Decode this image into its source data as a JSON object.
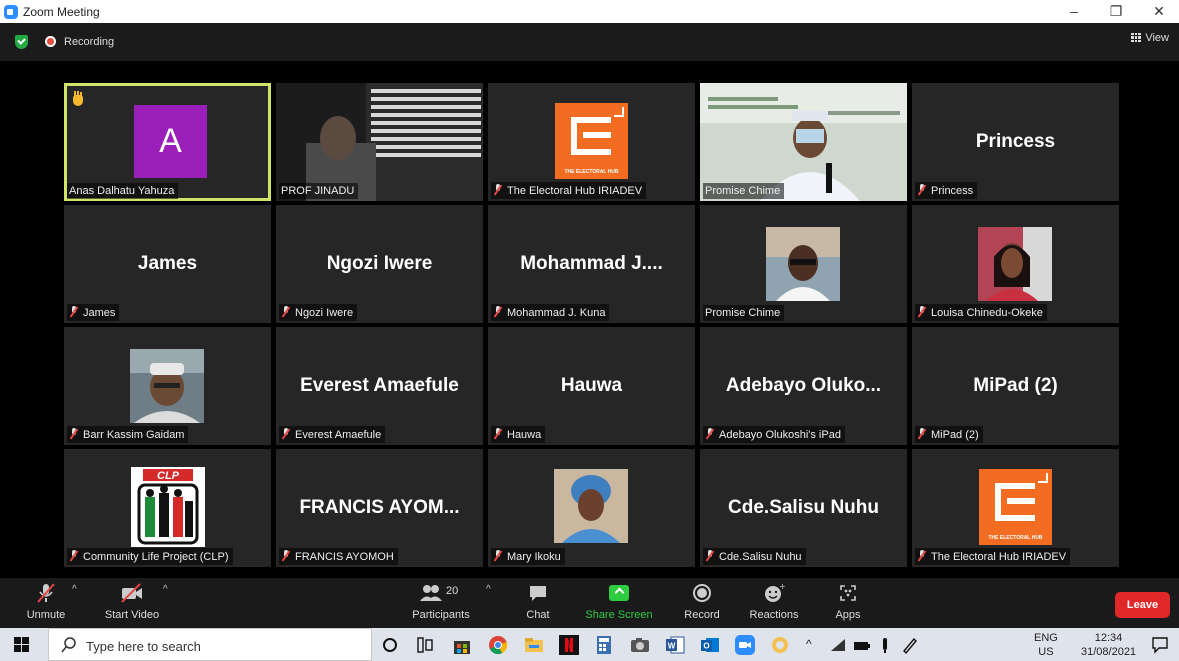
{
  "window": {
    "title": "Zoom Meeting",
    "minimize": "–",
    "restore": "❐",
    "close": "✕"
  },
  "topbar": {
    "recording_label": "Recording",
    "view_label": "View"
  },
  "gallery": {
    "tiles": [
      {
        "name": "Anas Dalhatu Yahuza",
        "initial": "A"
      },
      {
        "name": "PROF JINADU"
      },
      {
        "name": "The Electoral Hub IRIADEV",
        "logo_text": "THE ELECTORAL HUB"
      },
      {
        "name": "Promise Chime"
      },
      {
        "name": "Princess",
        "display": "Princess"
      },
      {
        "name": "James",
        "display": "James"
      },
      {
        "name": "Ngozi Iwere",
        "display": "Ngozi Iwere"
      },
      {
        "name": "Mohammad J. Kuna",
        "display": "Mohammad J...."
      },
      {
        "name": "Promise Chime"
      },
      {
        "name": "Louisa Chinedu-Okeke"
      },
      {
        "name": "Barr Kassim Gaidam"
      },
      {
        "name": "Everest Amaefule",
        "display": "Everest Amaefule"
      },
      {
        "name": "Hauwa",
        "display": "Hauwa"
      },
      {
        "name": "Adebayo Olukoshi's iPad",
        "display": "Adebayo Oluko..."
      },
      {
        "name": "MiPad (2)",
        "display": "MiPad (2)"
      },
      {
        "name": "Community Life Project (CLP)",
        "logo_text": "CLP"
      },
      {
        "name": "FRANCIS AYOMOH",
        "display": "FRANCIS AYOM..."
      },
      {
        "name": "Mary Ikoku"
      },
      {
        "name": "Cde.Salisu Nuhu",
        "display": "Cde.Salisu Nuhu"
      },
      {
        "name": "The Electoral Hub IRIADEV",
        "logo_text": "THE ELECTORAL HUB"
      }
    ]
  },
  "toolbar": {
    "unmute": "Unmute",
    "start_video": "Start Video",
    "participants": "Participants",
    "participants_count": "20",
    "chat": "Chat",
    "share_screen": "Share Screen",
    "record": "Record",
    "reactions": "Reactions",
    "apps": "Apps",
    "leave": "Leave",
    "caret": "^"
  },
  "taskbar": {
    "search_placeholder": "Type here to search",
    "lang_top": "ENG",
    "lang_bottom": "US",
    "time": "12:34",
    "date": "31/08/2021",
    "tray_caret": "^"
  },
  "colors": {
    "active_speaker": "#cfe36a",
    "share_green": "#2ecc40",
    "leave_red": "#e02828",
    "zoom_blue": "#2D8CFF"
  }
}
